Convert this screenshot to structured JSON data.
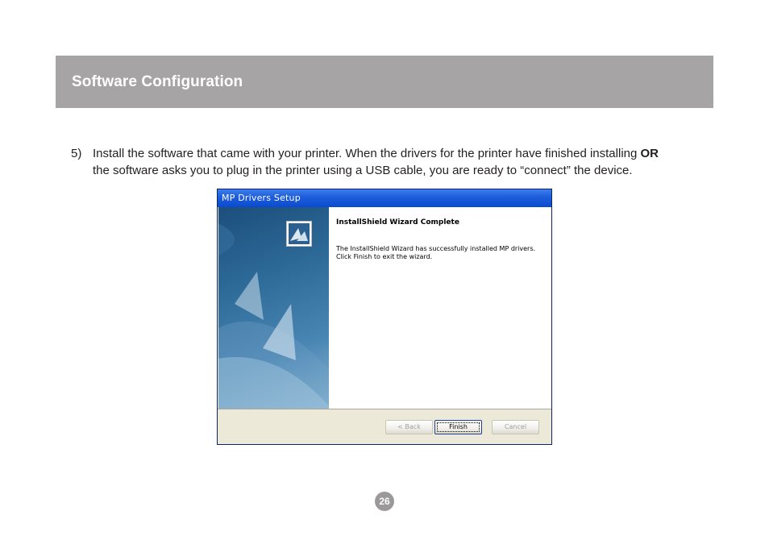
{
  "header": {
    "title": "Software Configuration"
  },
  "step": {
    "number": "5)",
    "text_part1": "Install the software that came with your printer.  When the drivers for the printer have finished installing ",
    "text_bold": "OR",
    "text_part2": " the software asks you to plug in the printer using a USB cable, you are ready to “connect” the device."
  },
  "dialog": {
    "title": "MP Drivers Setup",
    "heading": "InstallShield Wizard Complete",
    "message_line1": "The InstallShield Wizard has successfully installed MP drivers.",
    "message_line2": "Click Finish to exit the wizard.",
    "buttons": {
      "back_label": "< Back",
      "finish_label": "Finish",
      "cancel_label": "Cancel"
    },
    "logo_icon": "installshield-logo-icon"
  },
  "footer": {
    "page_number": "26"
  },
  "colors": {
    "header_bg": "#a6a4a4",
    "titlebar": "#0a4ad0",
    "page_badge": "#9b9999"
  }
}
